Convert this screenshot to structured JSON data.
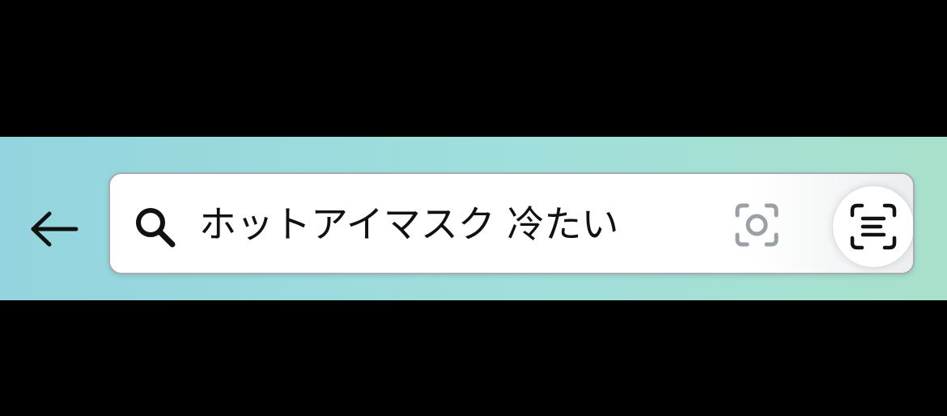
{
  "search": {
    "query": "ホットアイマスク 冷たい"
  },
  "icons": {
    "back": "arrow-left-icon",
    "search": "search-icon",
    "camera": "camera-lens-icon",
    "scan": "text-scan-icon"
  },
  "colors": {
    "bar_gradient_start": "#93d4de",
    "bar_gradient_end": "#a8e0cb",
    "field_border": "#a6adb2",
    "icon_gray": "#9aa1a6",
    "icon_dark": "#111111"
  }
}
